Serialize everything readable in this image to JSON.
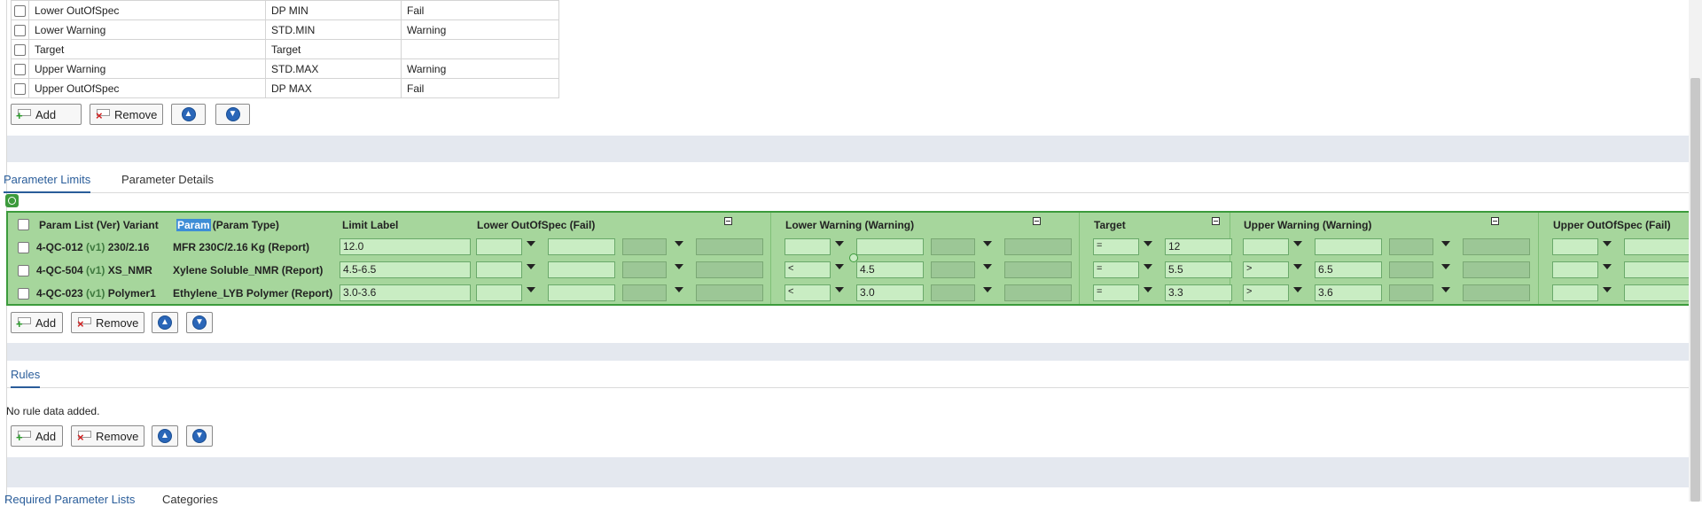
{
  "limit_label_table": {
    "rows": [
      {
        "name": "Lower OutOfSpec",
        "label": "DP MIN",
        "status": "Fail"
      },
      {
        "name": "Lower Warning",
        "label": "STD.MIN",
        "status": "Warning"
      },
      {
        "name": "Target",
        "label": "Target",
        "status": ""
      },
      {
        "name": "Upper Warning",
        "label": "STD.MAX",
        "status": "Warning"
      },
      {
        "name": "Upper OutOfSpec",
        "label": "DP MAX",
        "status": "Fail"
      }
    ]
  },
  "buttons": {
    "add": "Add",
    "remove": "Remove"
  },
  "tabs_section1": {
    "parameter_limits": "Parameter Limits",
    "parameter_details": "Parameter Details"
  },
  "grid": {
    "headers": {
      "param_list": "Param List (Ver) Variant",
      "param_hl": "Param",
      "param_type": "(Param Type)",
      "limit_label": "Limit Label",
      "lower_oos": "Lower OutOfSpec (Fail)",
      "lower_warning": "Lower Warning (Warning)",
      "target": "Target",
      "upper_warning": "Upper Warning (Warning)",
      "upper_oos": "Upper OutOfSpec (Fail)"
    },
    "rows": [
      {
        "pl": "4-QC-012",
        "ver": "(v1)",
        "variant": "230/2.16",
        "param": "MFR 230C/2.16 Kg (Report)",
        "limit_label": "12.0",
        "lw_op": "",
        "lw_val": "",
        "t_op": "=",
        "t_val": "12",
        "uw_op": "",
        "uw_val": ""
      },
      {
        "pl": "4-QC-504",
        "ver": "(v1)",
        "variant": "XS_NMR",
        "param": "Xylene Soluble_NMR (Report)",
        "limit_label": "4.5-6.5",
        "lw_op": "<",
        "lw_val": "4.5",
        "t_op": "=",
        "t_val": "5.5",
        "uw_op": ">",
        "uw_val": "6.5"
      },
      {
        "pl": "4-QC-023",
        "ver": "(v1)",
        "variant": "Polymer1",
        "param": "Ethylene_LYB Polymer (Report)",
        "limit_label": "3.0-3.6",
        "lw_op": "<",
        "lw_val": "3.0",
        "t_op": "=",
        "t_val": "3.3",
        "uw_op": ">",
        "uw_val": "3.6"
      }
    ]
  },
  "rules": {
    "tab": "Rules",
    "empty": "No rule data added."
  },
  "tabs_section3": {
    "required": "Required Parameter Lists",
    "categories": "Categories"
  },
  "colors": {
    "grid_bg": "#a6d69c",
    "grid_border": "#3c9b3c",
    "tab_active": "#2a5d9a"
  }
}
